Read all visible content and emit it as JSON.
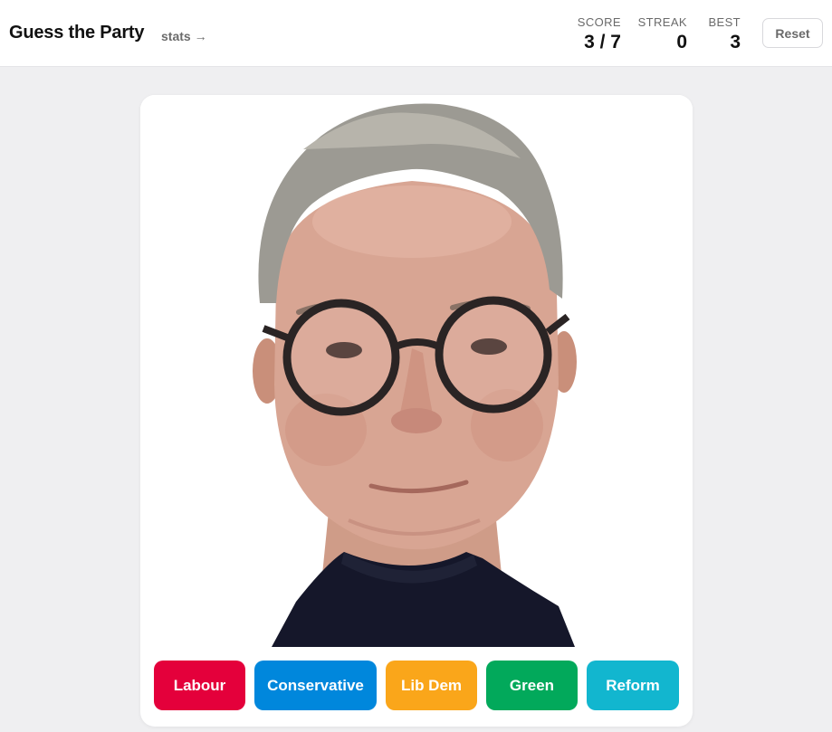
{
  "header": {
    "title": "Guess the Party",
    "stats_link": "stats →"
  },
  "scoreboard": {
    "score_label": "SCORE",
    "score_value": "3 / 7",
    "streak_label": "STREAK",
    "streak_value": "0",
    "best_label": "BEST",
    "best_value": "3",
    "reset_label": "Reset"
  },
  "portrait": {
    "subject": "portrait photo of a man with grey hair, round dark glasses and a navy turtleneck",
    "background_color": "#ffffff"
  },
  "choices": [
    {
      "label": "Labour",
      "color": "#e4003b"
    },
    {
      "label": "Conservative",
      "color": "#0087dc"
    },
    {
      "label": "Lib Dem",
      "color": "#faa61a"
    },
    {
      "label": "Green",
      "color": "#02a95b"
    },
    {
      "label": "Reform",
      "color": "#12b6cf"
    }
  ]
}
